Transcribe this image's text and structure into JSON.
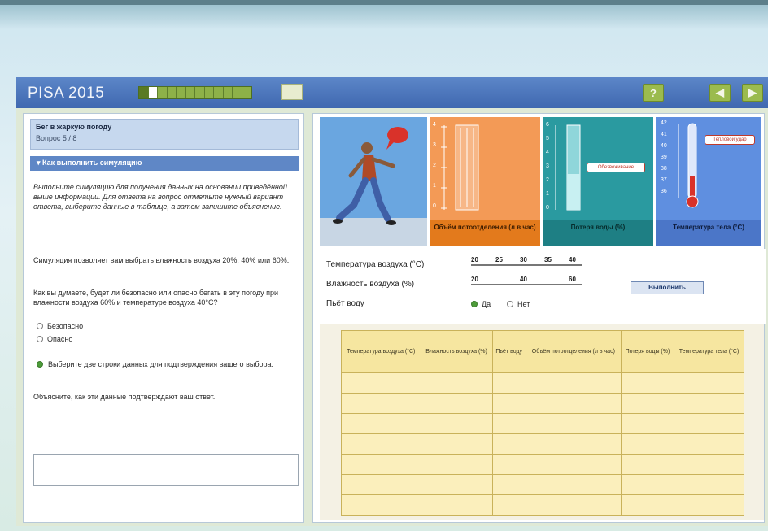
{
  "header": {
    "brand": "PISA 2015",
    "help_label": "?",
    "back_label": "◀",
    "next_label": "▶"
  },
  "progress": {
    "segments": 12,
    "current": 2
  },
  "question": {
    "title": "Бег в жаркую погоду",
    "number": "Вопрос 5 / 8"
  },
  "how_to": "Как выполнить симуляцию",
  "instructions_italic": "Выполните симуляцию для получения данных на основании приведённой выше информации. Для ответа на вопрос отметьте нужный вариант ответа, выберите данные в таблице, а затем запишите объяснение.",
  "simulation_note": "Симуляция позволяет вам выбрать влажность воздуха 20%, 40% или 60%.",
  "prompt": "Как вы думаете, будет ли безопасно или опасно бегать в эту погоду при влажности воздуха 60% и температуре воздуха 40°С?",
  "options": [
    "Безопасно",
    "Опасно"
  ],
  "select_rows_text": "Выберите две строки данных для подтверждения вашего выбора.",
  "explain_text": "Объясните, как эти данные подтверждают ваш ответ.",
  "panels": {
    "sweat_label": "Объём потоотделения (л в час)",
    "water_loss_label": "Потеря воды (%)",
    "body_temp_label": "Температура тела (°С)",
    "water_callout": "Обезвоживание",
    "temp_callout": "Тепловой удар",
    "sweat_scale": [
      "4",
      "3",
      "2",
      "1",
      "0"
    ],
    "water_scale": [
      "6",
      "5",
      "4",
      "3",
      "2",
      "1",
      "0"
    ],
    "temp_scale": [
      "42",
      "41",
      "40",
      "39",
      "38",
      "37",
      "36"
    ]
  },
  "controls": {
    "air_temp_label": "Температура воздуха (°С)",
    "air_temp_ticks": [
      "20",
      "25",
      "30",
      "35",
      "40"
    ],
    "humidity_label": "Влажность воздуха (%)",
    "humidity_ticks": [
      "20",
      "40",
      "60"
    ],
    "drink_label": "Пьёт воду",
    "drink_yes": "Да",
    "drink_no": "Нет",
    "run_button": "Выполнить"
  },
  "table": {
    "headers": [
      "Температура воздуха (°С)",
      "Влажность воздуха (%)",
      "Пьёт воду",
      "Объём потоотделения (л в час)",
      "Потеря воды (%)",
      "Температура тела (°С)"
    ],
    "row_count": 8
  },
  "colors": {
    "title_bar": "#3f68b0",
    "progress_green": "#7a9e3c",
    "sweat_panel": "#f39a56",
    "water_panel": "#2a9aa0",
    "temp_panel": "#5f8fe0",
    "table_fill": "#fbefbc"
  }
}
